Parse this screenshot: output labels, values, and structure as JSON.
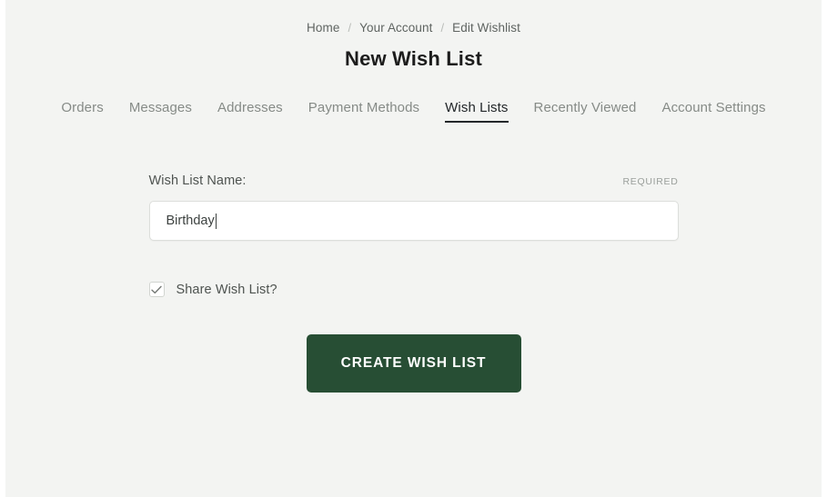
{
  "breadcrumb": {
    "separator": "/",
    "items": [
      {
        "label": "Home"
      },
      {
        "label": "Your Account"
      },
      {
        "label": "Edit Wishlist"
      }
    ]
  },
  "header": {
    "title": "New Wish List"
  },
  "nav": {
    "tabs": [
      {
        "label": "Orders",
        "active": false
      },
      {
        "label": "Messages",
        "active": false
      },
      {
        "label": "Addresses",
        "active": false
      },
      {
        "label": "Payment Methods",
        "active": false
      },
      {
        "label": "Wish Lists",
        "active": true
      },
      {
        "label": "Recently Viewed",
        "active": false
      },
      {
        "label": "Account Settings",
        "active": false
      }
    ]
  },
  "form": {
    "name_field": {
      "label": "Wish List Name:",
      "required_flag": "REQUIRED",
      "value": "Birthday",
      "placeholder": ""
    },
    "share_checkbox": {
      "label": "Share Wish List?",
      "checked": true,
      "icon": "checkmark-icon"
    },
    "submit": {
      "label": "CREATE WISH LIST"
    }
  },
  "colors": {
    "page_background": "#f3f4f2",
    "button_green": "#274e34",
    "text_dark": "#1c1c1c",
    "text_muted": "#868b87",
    "input_border": "#dcdedb"
  }
}
